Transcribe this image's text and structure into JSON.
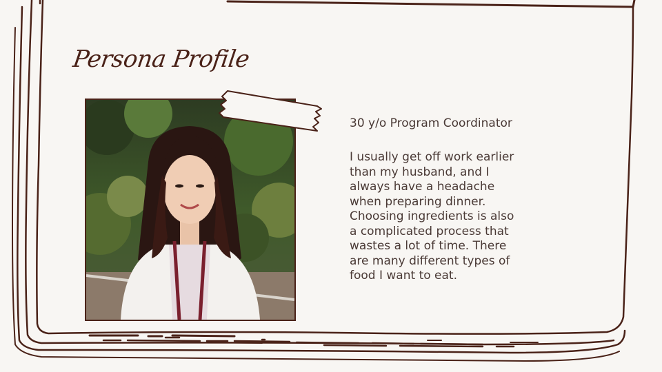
{
  "slide": {
    "title": "Persona Profile",
    "subtitle": "30 y/o Program Coordinator",
    "quote": "I usually get off work earlier than my husband, and I always have a headache when preparing dinner. Choosing ingredients is also a complicated process that wastes a lot of time. There are many different types of food I want to eat."
  },
  "colors": {
    "background": "#f8f6f3",
    "frame": "#4a2218",
    "text": "#4a3a36"
  },
  "icons": {
    "tape": "washi-tape",
    "photo": "persona-photo"
  }
}
